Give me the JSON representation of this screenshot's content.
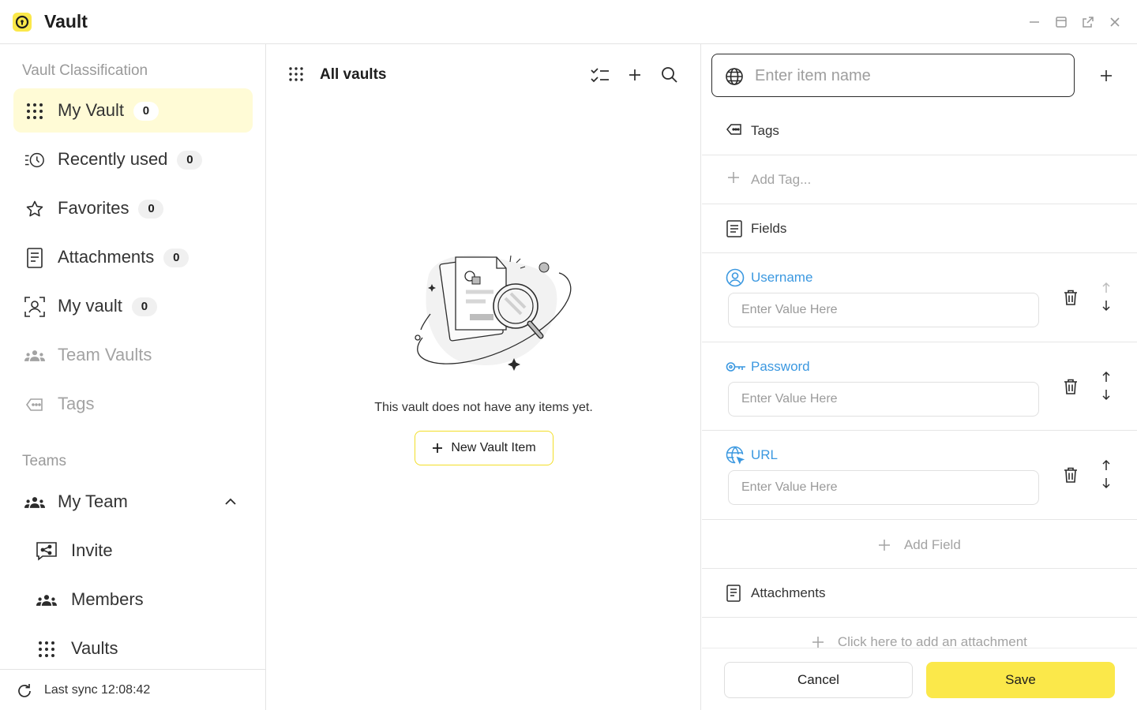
{
  "window": {
    "title": "Vault",
    "logo_icon": "vault-logo-icon",
    "controls": [
      "minimize-icon",
      "maximize-icon",
      "popout-icon",
      "close-icon"
    ],
    "accent": "#fbe84a"
  },
  "sidebar": {
    "classification_heading": "Vault Classification",
    "items": [
      {
        "label": "My Vault",
        "count": "0",
        "icon": "grid-dots-icon",
        "active": true
      },
      {
        "label": "Recently used",
        "count": "0",
        "icon": "recent-clock-icon"
      },
      {
        "label": "Favorites",
        "count": "0",
        "icon": "star-icon"
      },
      {
        "label": "Attachments",
        "count": "0",
        "icon": "document-icon"
      },
      {
        "label": "My vault",
        "count": "0",
        "icon": "user-frame-icon"
      },
      {
        "label": "Team Vaults",
        "icon": "team-icon"
      },
      {
        "label": "Tags",
        "icon": "tag-icon"
      }
    ],
    "teams_heading": "Teams",
    "team": {
      "label": "My Team",
      "icon": "team-icon",
      "subitems": [
        {
          "label": "Invite",
          "icon": "share-icon"
        },
        {
          "label": "Members",
          "icon": "team-icon"
        },
        {
          "label": "Vaults",
          "icon": "grid-dots-icon"
        }
      ]
    },
    "sync_text": "Last sync 12:08:42"
  },
  "list": {
    "title": "All vaults",
    "empty_text": "This vault does not have any items yet.",
    "new_item_label": "New Vault Item"
  },
  "detail": {
    "name_placeholder": "Enter item name",
    "tags_label": "Tags",
    "add_tag_label": "Add Tag...",
    "fields_label": "Fields",
    "fields": [
      {
        "label": "Username",
        "icon": "user-circle-icon",
        "placeholder": "Enter Value Here"
      },
      {
        "label": "Password",
        "icon": "key-icon",
        "placeholder": "Enter Value Here"
      },
      {
        "label": "URL",
        "icon": "globe-link-icon",
        "placeholder": "Enter Value Here"
      }
    ],
    "add_field_label": "Add Field",
    "attachments_label": "Attachments",
    "add_attachment_label": "Click here to add an attachment",
    "cancel_label": "Cancel",
    "save_label": "Save",
    "field_label_color": "#3b98e0"
  }
}
